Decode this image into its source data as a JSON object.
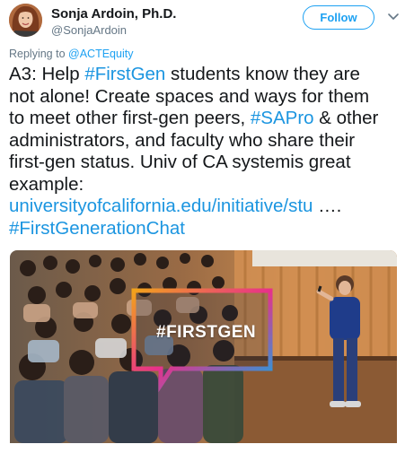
{
  "author": {
    "name": "Sonja Ardoin, Ph.D.",
    "handle": "@SonjaArdoin"
  },
  "actions": {
    "follow_label": "Follow",
    "more_icon": "chevron-down-icon"
  },
  "reply": {
    "prefix": "Replying to",
    "mention": "@ACTEquity"
  },
  "tweet": {
    "line1_a": "A3: Help ",
    "line1_tag": "#FirstGen",
    "line1_b": " students know they are",
    "line2": "not alone! Create spaces and ways for them",
    "line3_a": "to meet other first-gen peers, ",
    "line3_tag": "#SAPro",
    "line3_b": " & other",
    "line4": "administrators, and faculty who share their",
    "line5": "first-gen status. Univ of CA systemis great",
    "line6": "example:",
    "url": "universityofcalifornia.edu/initiative/stu",
    "url_ellipsis": " ….",
    "hashtag": "#FirstGenerationChat"
  },
  "media": {
    "overlay_text": "#FIRSTGEN"
  },
  "colors": {
    "accent": "#1da1f2",
    "link": "#1b95e0",
    "muted": "#657786",
    "text": "#14171a"
  }
}
